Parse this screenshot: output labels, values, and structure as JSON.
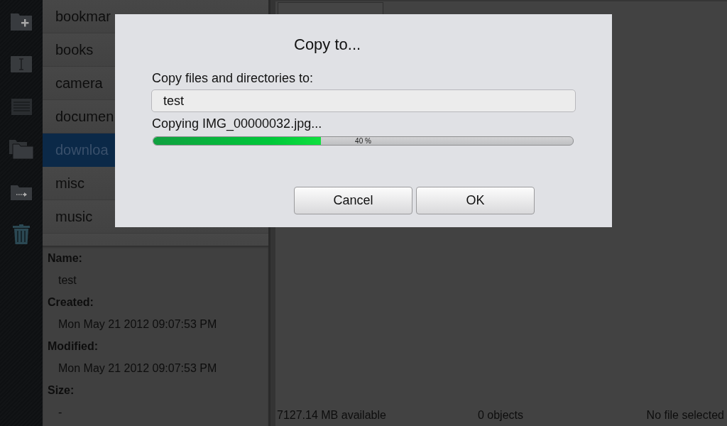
{
  "folders": [
    {
      "label": "bookmar",
      "selected": false
    },
    {
      "label": "books",
      "selected": false
    },
    {
      "label": "camera",
      "selected": false
    },
    {
      "label": "documen",
      "selected": false
    },
    {
      "label": "downloa",
      "selected": true
    },
    {
      "label": "misc",
      "selected": false
    },
    {
      "label": "music",
      "selected": false
    }
  ],
  "info": [
    {
      "label": "Name:",
      "value": "test"
    },
    {
      "label": "Created:",
      "value": "Mon May 21 2012 09:07:53 PM"
    },
    {
      "label": "Modified:",
      "value": "Mon May 21 2012 09:07:53 PM"
    },
    {
      "label": "Size:",
      "value": "-"
    }
  ],
  "status_bar": {
    "available": "7127.14 MB available",
    "objects": "0 objects",
    "selection": "No file selected"
  },
  "dialog": {
    "title": "Copy to...",
    "prompt": "Copy files and directories to:",
    "destination": {
      "value": "test"
    },
    "progress": {
      "status": "Copying IMG_00000032.jpg...",
      "level": 0.4,
      "reading": "40 %"
    },
    "buttons": [
      "Cancel",
      "OK"
    ]
  }
}
